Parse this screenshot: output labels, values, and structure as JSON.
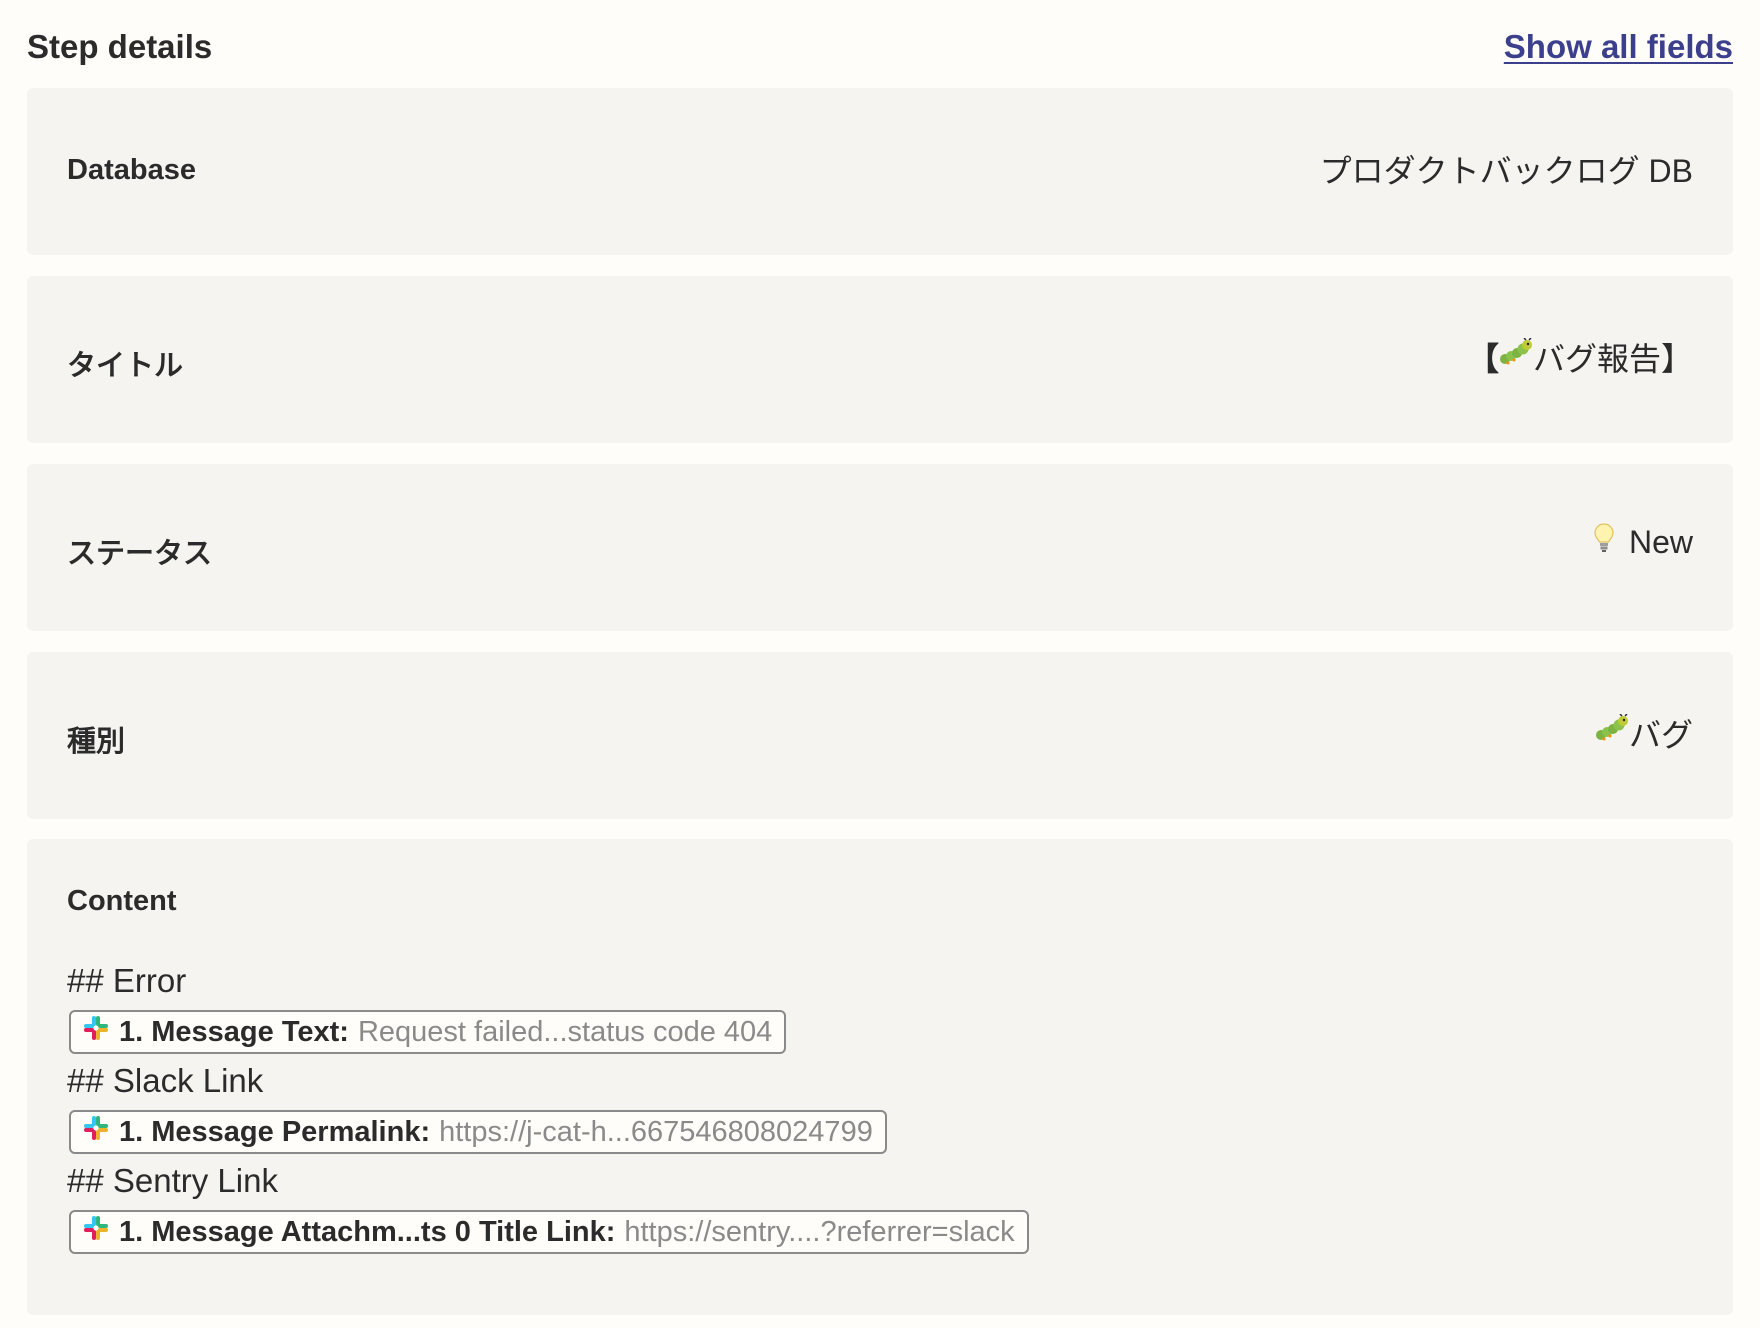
{
  "header": {
    "title": "Step details",
    "show_all_link": "Show all fields"
  },
  "fields": [
    {
      "label": "Database",
      "value": "プロダクトバックログ DB",
      "icon": null
    },
    {
      "label": "タイトル",
      "value_prefix": "【",
      "icon": "caterpillar-icon",
      "value": " バグ報告】"
    },
    {
      "label": "ステータス",
      "icon": "lightbulb-icon",
      "value": "New"
    },
    {
      "label": "種別",
      "icon": "caterpillar-icon",
      "value": "バグ"
    }
  ],
  "content": {
    "label": "Content",
    "sections": [
      {
        "heading": "## Error",
        "pill": {
          "icon": "slack-icon",
          "label": "1. Message Text:",
          "value": "Request failed...status code 404"
        }
      },
      {
        "heading": "## Slack Link",
        "pill": {
          "icon": "slack-icon",
          "label": "1. Message Permalink:",
          "value": "https://j-cat-h...667546808024799"
        }
      },
      {
        "heading": "## Sentry Link",
        "pill": {
          "icon": "slack-icon",
          "label": "1. Message Attachm...ts 0 Title Link:",
          "value": "https://sentry....?referrer=slack"
        }
      }
    ]
  },
  "colors": {
    "link": "#3b3f8c",
    "card_bg": "#f5f4f1",
    "page_bg": "#fffdf9",
    "muted_text": "#8a8a8a"
  }
}
